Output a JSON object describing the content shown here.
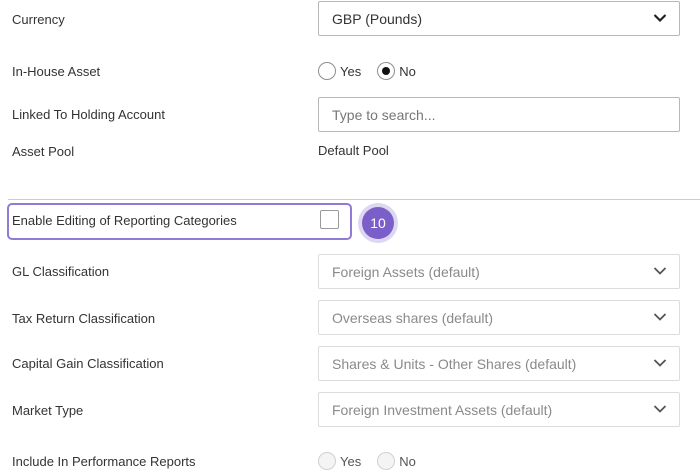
{
  "fields": {
    "currency": {
      "label": "Currency",
      "value": "GBP (Pounds)"
    },
    "in_house_asset": {
      "label": "In-House Asset",
      "yes_label": "Yes",
      "no_label": "No",
      "selected": "No"
    },
    "linked_holding": {
      "label": "Linked To Holding Account",
      "placeholder": "Type to search..."
    },
    "asset_pool": {
      "label": "Asset Pool",
      "value": "Default Pool"
    },
    "enable_editing": {
      "label": "Enable Editing of Reporting Categories",
      "checked": false
    },
    "gl_classification": {
      "label": "GL Classification",
      "value": "Foreign Assets (default)"
    },
    "tax_return_classification": {
      "label": "Tax Return Classification",
      "value": "Overseas shares (default)"
    },
    "capital_gain_classification": {
      "label": "Capital Gain Classification",
      "value": "Shares & Units - Other Shares (default)"
    },
    "market_type": {
      "label": "Market Type",
      "value": "Foreign Investment Assets (default)"
    },
    "include_performance": {
      "label": "Include In Performance Reports",
      "yes_label": "Yes",
      "no_label": "No"
    }
  },
  "step_badge": {
    "number": "10",
    "color": "#7b5fc8"
  },
  "colors": {
    "highlight": "#8f7ad6",
    "text": "#333333",
    "disabled_text": "#8a8a8a"
  },
  "icons": {
    "dropdown": "chevron-down-icon"
  }
}
